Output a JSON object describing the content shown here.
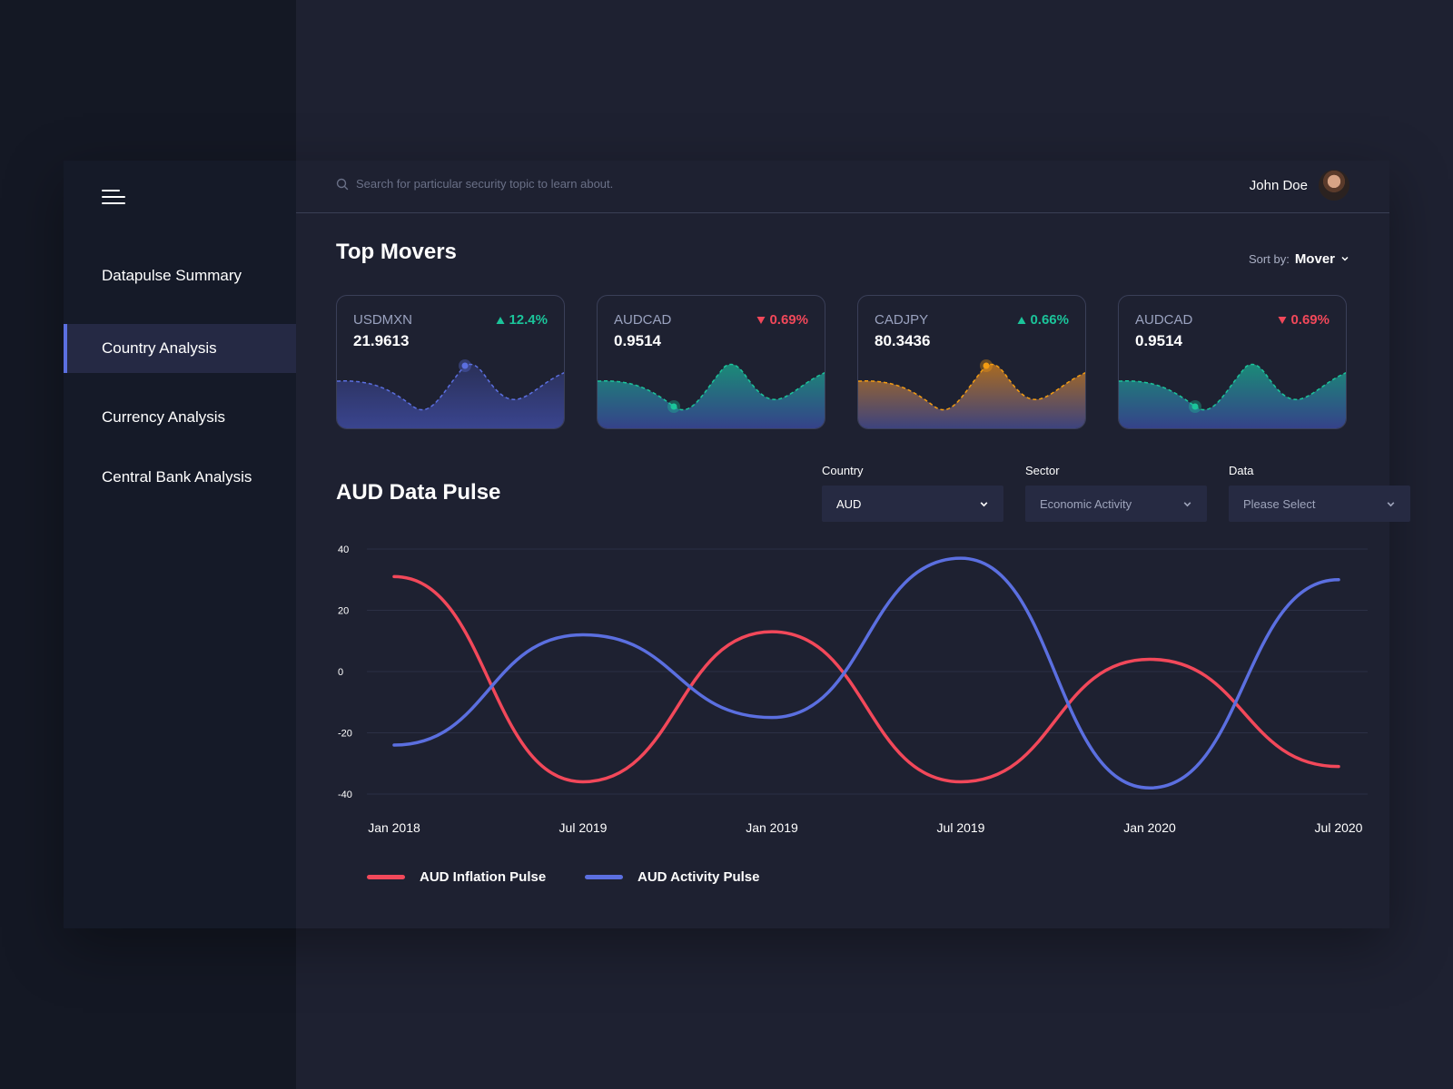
{
  "header": {
    "search_placeholder": "Search for particular security topic to learn about.",
    "user_name": "John Doe"
  },
  "sidebar": {
    "items": [
      {
        "label": "Datapulse Summary",
        "active": false
      },
      {
        "label": "Country Analysis",
        "active": true
      },
      {
        "label": "Currency Analysis",
        "active": false
      },
      {
        "label": "Central Bank Analysis",
        "active": false
      }
    ]
  },
  "top_movers": {
    "title": "Top Movers",
    "sort_label": "Sort by:",
    "sort_value": "Mover",
    "cards": [
      {
        "pair": "USDMXN",
        "price": "21.9613",
        "change": "12.4%",
        "direction": "up",
        "color": "#5b6fe0"
      },
      {
        "pair": "AUDCAD",
        "price": "0.9514",
        "change": "0.69%",
        "direction": "down",
        "color": "#1bc49a"
      },
      {
        "pair": "CADJPY",
        "price": "80.3436",
        "change": "0.66%",
        "direction": "up",
        "color": "#f39c12"
      },
      {
        "pair": "AUDCAD",
        "price": "0.9514",
        "change": "0.69%",
        "direction": "down",
        "color": "#1bc49a"
      }
    ]
  },
  "pulse": {
    "title": "AUD Data Pulse",
    "filters": [
      {
        "label": "Country",
        "value": "AUD"
      },
      {
        "label": "Sector",
        "value": "Economic Activity"
      },
      {
        "label": "Data",
        "value": "Please Select"
      }
    ]
  },
  "colors": {
    "up": "#1bc49a",
    "down": "#f2485a",
    "accent": "#5b6fe0"
  },
  "chart_data": {
    "type": "line",
    "x": [
      "Jan 2018",
      "Jul 2019",
      "Jan 2019",
      "Jul 2019",
      "Jan 2020",
      "Jul 2020"
    ],
    "yticks": [
      40,
      20,
      0,
      -20,
      -40
    ],
    "ylim": [
      -40,
      40
    ],
    "grid": true,
    "legend_position": "bottom-left",
    "series": [
      {
        "name": "AUD Inflation Pulse",
        "color": "#f2485a",
        "values": [
          31,
          -36,
          13,
          -36,
          4,
          -31
        ]
      },
      {
        "name": "AUD Activity Pulse",
        "color": "#5b6fe0",
        "values": [
          -24,
          12,
          -15,
          37,
          -38,
          30
        ]
      }
    ]
  }
}
